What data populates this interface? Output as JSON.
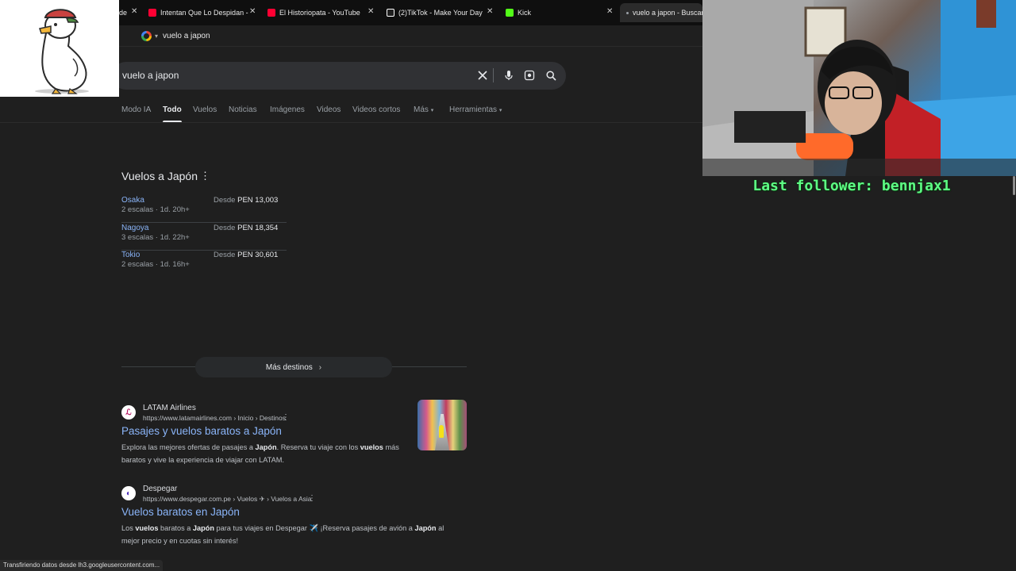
{
  "browser": {
    "tabs": [
      {
        "label": "de",
        "favicon_color": "#1f1f1f"
      },
      {
        "label": "Intentan Que Lo Despidan - You",
        "favicon_color": "#ff0033"
      },
      {
        "label": "El Historiopata - YouTube",
        "favicon_color": "#ff0033"
      },
      {
        "label": "(2)TikTok - Make Your Day",
        "favicon_color": "#ffffff"
      },
      {
        "label": "Kick",
        "favicon_color": "#53fc18"
      },
      {
        "label": "vuelo a japon - Buscar c",
        "favicon_color": "#9aa0a6"
      }
    ],
    "close_glyph": "✕",
    "address": "vuelo a japon",
    "address_chevron": "▾"
  },
  "search": {
    "query": "vuelo a japon",
    "icons": [
      "clear-icon",
      "mic-icon",
      "lens-icon",
      "search-icon"
    ]
  },
  "nav": {
    "tabs": [
      "Modo IA",
      "Todo",
      "Vuelos",
      "Noticias",
      "Imágenes",
      "Videos",
      "Videos cortos",
      "Más",
      "Herramientas"
    ],
    "active": "Todo",
    "caret": "▾"
  },
  "flights": {
    "title": "Vuelos a Japón",
    "more_glyph": "⋮",
    "rows": [
      {
        "city": "Osaka",
        "meta": "2 escalas · 1d. 20h+",
        "price_prefix": "Desde",
        "price": "PEN 13,003"
      },
      {
        "city": "Nagoya",
        "meta": "3 escalas · 1d. 22h+",
        "price_prefix": "Desde",
        "price": "PEN 18,354"
      },
      {
        "city": "Tokio",
        "meta": "2 escalas · 1d. 16h+",
        "price_prefix": "Desde",
        "price": "PEN 30,601"
      }
    ],
    "more_destinations": "Más destinos",
    "more_arrow": "›"
  },
  "results": [
    {
      "site": "LATAM Airlines",
      "url": "https://www.latamairlines.com › Inicio › Destinos",
      "title": "Pasajes y vuelos baratos a Japón",
      "snippet_parts": [
        {
          "t": "Explora las mejores ofertas de pasajes a ",
          "b": false
        },
        {
          "t": "Japón",
          "b": true
        },
        {
          "t": ". Reserva tu viaje con los ",
          "b": false
        },
        {
          "t": "vuelos",
          "b": true
        },
        {
          "t": " más baratos y vive la experiencia de viajar con LATAM.",
          "b": false
        }
      ],
      "favicon_glyph": "ℒ",
      "favicon_color": "#b5125e"
    },
    {
      "site": "Despegar",
      "url": "https://www.despegar.com.pe › Vuelos ✈ › Vuelos a Asia",
      "title": "Vuelos baratos en Japón",
      "snippet_parts": [
        {
          "t": "Los ",
          "b": false
        },
        {
          "t": "vuelos",
          "b": true
        },
        {
          "t": " baratos a ",
          "b": false
        },
        {
          "t": "Japón",
          "b": true
        },
        {
          "t": " para tus viajes en Despegar ✈️ ¡Reserva pasajes de avión a ",
          "b": false
        },
        {
          "t": "Japón",
          "b": true
        },
        {
          "t": " al mejor precio y en cuotas sin interés!",
          "b": false
        }
      ],
      "favicon_glyph": "◐",
      "favicon_color": "#4b2bb8"
    }
  ],
  "status": "Transfiriendo datos desde lh3.googleusercontent.com...",
  "stream": {
    "follower_text": "Last follower: bennjax1"
  }
}
